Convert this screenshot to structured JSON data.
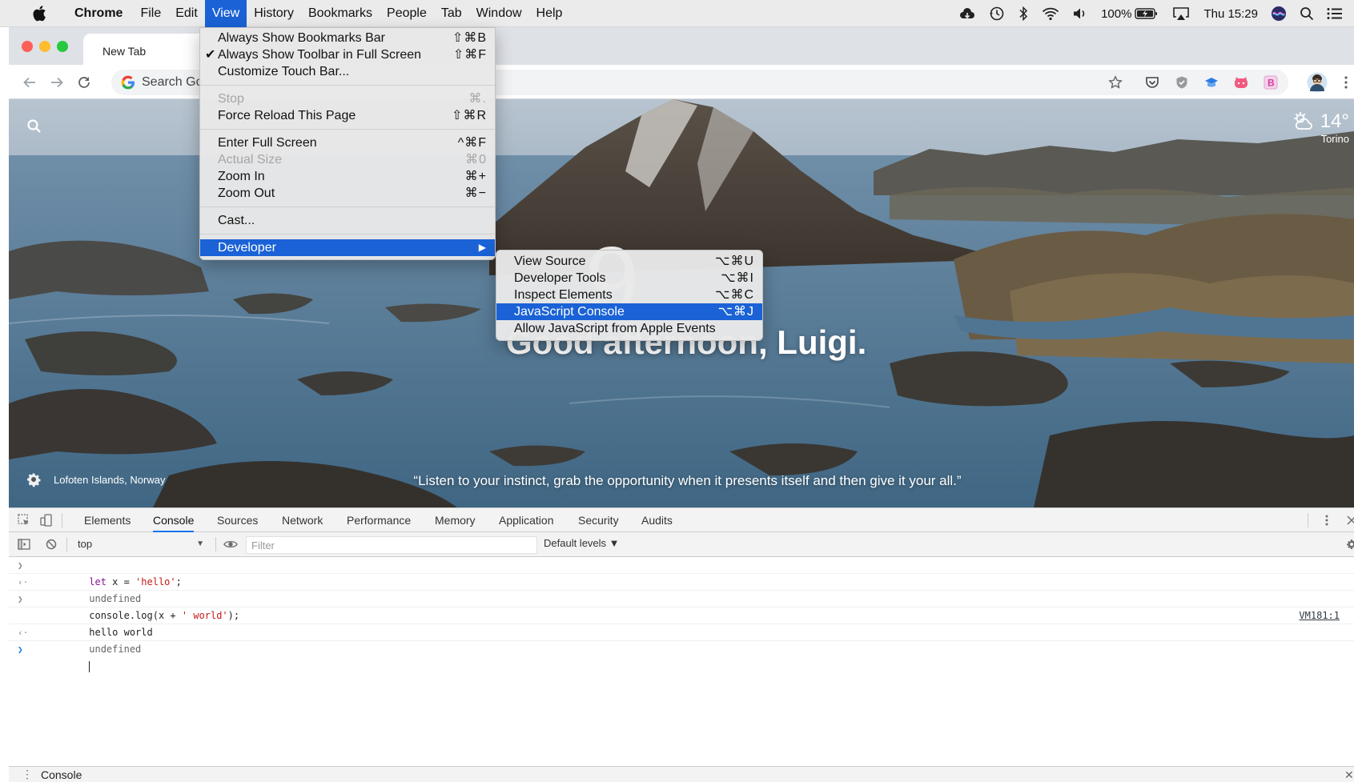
{
  "menubar": {
    "app_name": "Chrome",
    "items": [
      "File",
      "Edit",
      "View",
      "History",
      "Bookmarks",
      "People",
      "Tab",
      "Window",
      "Help"
    ],
    "active_item": "View",
    "status": {
      "battery": "100%",
      "clock": "Thu 15:29"
    }
  },
  "browser": {
    "tab_title": "New Tab",
    "omnibox_placeholder": "Search Go"
  },
  "view_menu": {
    "items": [
      {
        "label": "Always Show Bookmarks Bar",
        "shortcut": "⇧⌘B",
        "checked": false,
        "disabled": false
      },
      {
        "label": "Always Show Toolbar in Full Screen",
        "shortcut": "⇧⌘F",
        "checked": true,
        "disabled": false
      },
      {
        "label": "Customize Touch Bar...",
        "shortcut": "",
        "checked": false,
        "disabled": false
      },
      {
        "label": "Stop",
        "shortcut": "⌘.",
        "checked": false,
        "disabled": true
      },
      {
        "label": "Force Reload This Page",
        "shortcut": "⇧⌘R",
        "checked": false,
        "disabled": false
      },
      {
        "label": "Enter Full Screen",
        "shortcut": "^⌘F",
        "checked": false,
        "disabled": false
      },
      {
        "label": "Actual Size",
        "shortcut": "⌘0",
        "checked": false,
        "disabled": true
      },
      {
        "label": "Zoom In",
        "shortcut": "⌘+",
        "checked": false,
        "disabled": false
      },
      {
        "label": "Zoom Out",
        "shortcut": "⌘−",
        "checked": false,
        "disabled": false
      },
      {
        "label": "Cast...",
        "shortcut": "",
        "checked": false,
        "disabled": false
      },
      {
        "label": "Developer",
        "shortcut": "▶",
        "checked": false,
        "disabled": false,
        "highlighted": true
      }
    ]
  },
  "developer_submenu": {
    "items": [
      {
        "label": "View Source",
        "shortcut": "⌥⌘U",
        "highlighted": false
      },
      {
        "label": "Developer Tools",
        "shortcut": "⌥⌘I",
        "highlighted": false
      },
      {
        "label": "Inspect Elements",
        "shortcut": "⌥⌘C",
        "highlighted": false
      },
      {
        "label": "JavaScript Console",
        "shortcut": "⌥⌘J",
        "highlighted": true
      },
      {
        "label": "Allow JavaScript from Apple Events",
        "shortcut": "",
        "highlighted": false
      }
    ]
  },
  "newtab": {
    "clock_partial": "9",
    "greeting": "Good afternoon, Luigi.",
    "weather_temp": "14°",
    "weather_city": "Torino",
    "photo_location": "Lofoten Islands, Norway",
    "quote": "“Listen to your instinct, grab the opportunity when it presents itself and then give it your all.”"
  },
  "devtools": {
    "tabs": [
      "Elements",
      "Console",
      "Sources",
      "Network",
      "Performance",
      "Memory",
      "Application",
      "Security",
      "Audits"
    ],
    "selected_tab": "Console",
    "context": "top",
    "filter_placeholder": "Filter",
    "levels": "Default levels ▼",
    "console": {
      "line1": {
        "kw": "let",
        "a": " x = ",
        "str": "'hello'",
        "b": ";"
      },
      "line2": "undefined",
      "line3": {
        "a": "console.log(x + ",
        "str": "' world'",
        "b": ");"
      },
      "line4": "hello world",
      "line4_source": "VM181:1",
      "line5": "undefined"
    },
    "drawer_title": "Console"
  },
  "colors": {
    "menu_highlight": "#1a62d6",
    "devtools_tab_underline": "#1a73e8",
    "keyword": "#881391",
    "string": "#c41a16"
  }
}
